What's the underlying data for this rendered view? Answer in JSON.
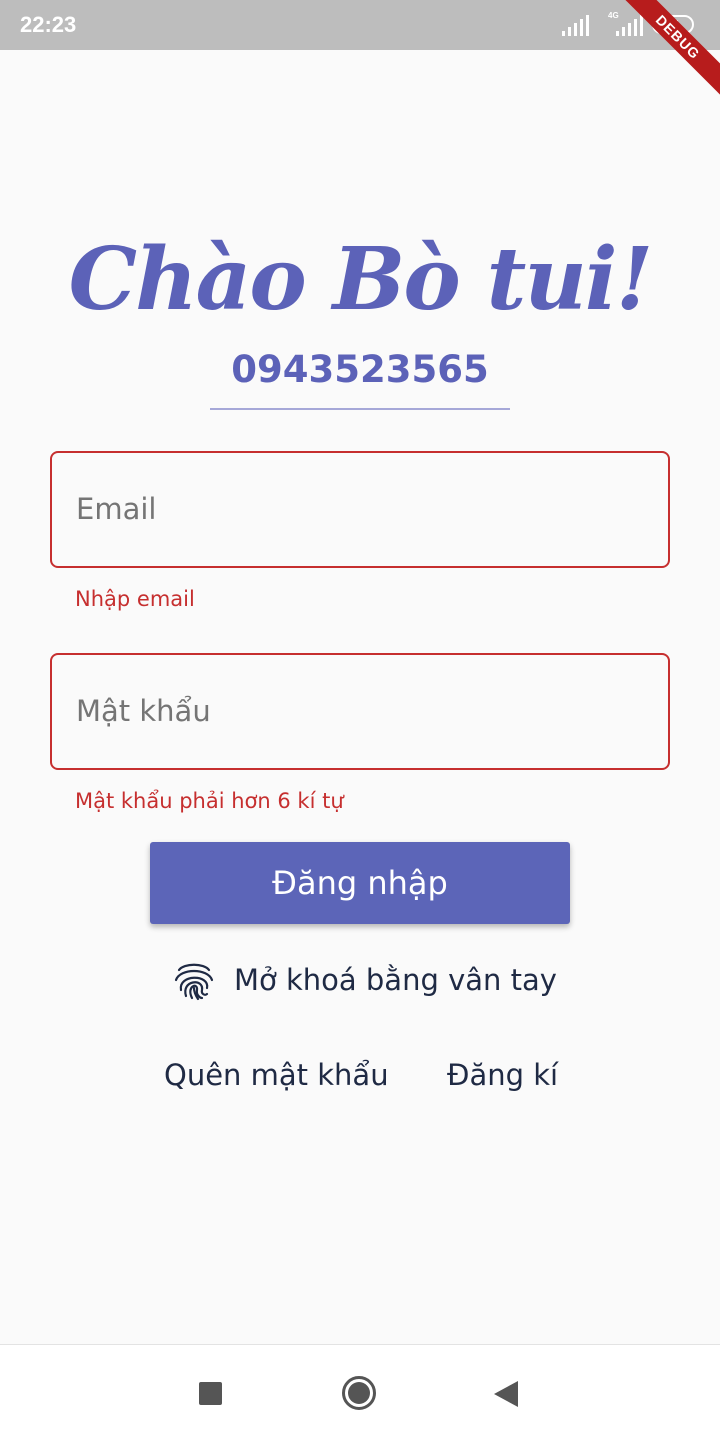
{
  "status_bar": {
    "time": "22:23",
    "network_label": "4G",
    "battery": "61",
    "debug_label": "DEBUG"
  },
  "header": {
    "greeting": "Chào Bò tui!",
    "phone": "0943523565"
  },
  "form": {
    "email": {
      "placeholder": "Email",
      "value": "",
      "error": "Nhập email"
    },
    "password": {
      "placeholder": "Mật khẩu",
      "value": "",
      "error": "Mật khẩu phải hơn 6 kí tự"
    },
    "login_label": "Đăng nhập",
    "fingerprint_label": "Mở khoá bằng vân tay",
    "forgot_label": "Quên mật khẩu",
    "register_label": "Đăng kí"
  },
  "icons": {
    "fingerprint": "fingerprint-icon",
    "recent_apps": "square-icon",
    "home": "circle-icon",
    "back": "triangle-back-icon"
  },
  "colors": {
    "accent": "#5c62b8",
    "error": "#c62f2f",
    "text_dark": "#1f2a44",
    "debug_banner": "#b71c1c"
  }
}
